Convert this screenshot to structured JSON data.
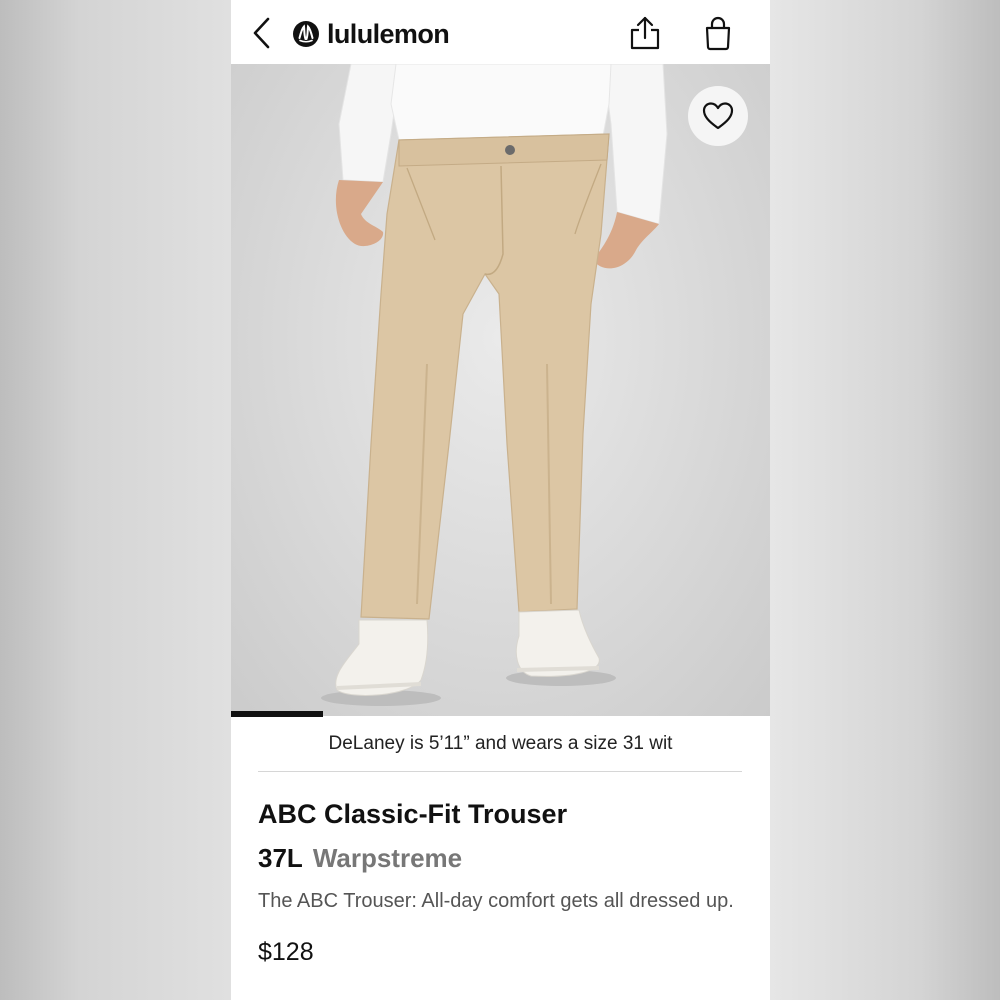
{
  "header": {
    "brand": "lululemon",
    "back_icon": "chevron-left-icon",
    "logo_icon": "lululemon-logo-icon",
    "share_icon": "share-icon",
    "bag_icon": "shopping-bag-icon"
  },
  "hero": {
    "wishlist_icon": "heart-icon",
    "image_progress_fraction": 0.17
  },
  "product": {
    "model_caption": "DeLaney is 5’11” and wears a size 31 wit",
    "title": "ABC Classic-Fit Trouser",
    "size": "37L",
    "fabric": "Warpstreme",
    "description": "The ABC Trouser: All-day comfort gets all dressed up.",
    "price": "$128"
  },
  "colors": {
    "pants": "#dcc6a4",
    "shirt": "#f7f7f7",
    "background": "#dcdcdc"
  }
}
